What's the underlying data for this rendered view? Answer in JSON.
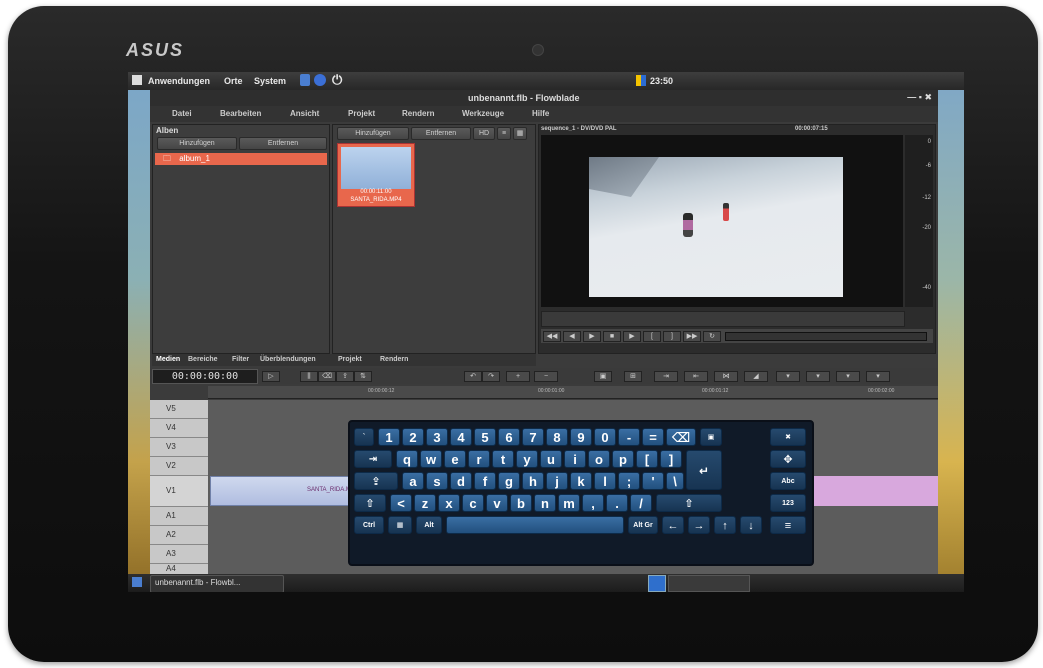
{
  "device": {
    "brand": "ASUS"
  },
  "topbar": {
    "menu_applications": "Anwendungen",
    "menu_places": "Orte",
    "menu_system": "System",
    "clock": "23:50"
  },
  "window": {
    "title": "unbenannt.flb - Flowblade"
  },
  "menubar": {
    "items": [
      "Datei",
      "Bearbeiten",
      "Ansicht",
      "Projekt",
      "Rendern",
      "Werkzeuge",
      "Hilfe"
    ]
  },
  "albums": {
    "header": "Alben",
    "add_button": "Hinzufügen",
    "remove_button": "Entfernen",
    "items": [
      "album_1"
    ]
  },
  "media": {
    "add_button": "Hinzufügen",
    "remove_button": "Entfernen",
    "hd_label": "HD",
    "clip_name": "SANTA_RIDA.MP4",
    "clip_duration": "00:00:11:00"
  },
  "monitor": {
    "sequence_label": "sequence_1 - DV/DVD PAL",
    "timecode": "00:00:07:15",
    "vu_labels": [
      "0",
      "-6",
      "-12",
      "-20",
      "-40"
    ]
  },
  "notebook_tabs": [
    "Medien",
    "Bereiche",
    "Filter",
    "Überblendungen",
    "Projekt",
    "Rendern"
  ],
  "timeline": {
    "timecode": "00:00:00:00",
    "ruler_ticks": [
      "00:00:00:12",
      "00:00:01:00",
      "00:00:01:12",
      "00:00:02:00"
    ],
    "video_tracks": [
      "V5",
      "V4",
      "V3",
      "V2",
      "V1"
    ],
    "audio_tracks": [
      "A1",
      "A2",
      "A3",
      "A4"
    ],
    "clip_label": "SANTA_RIDA.MP4"
  },
  "keyboard": {
    "row1": [
      "`",
      "1",
      "2",
      "3",
      "4",
      "5",
      "6",
      "7",
      "8",
      "9",
      "0",
      "-",
      "="
    ],
    "row2": [
      "q",
      "w",
      "e",
      "r",
      "t",
      "y",
      "u",
      "i",
      "o",
      "p",
      "[",
      "]"
    ],
    "row3": [
      "a",
      "s",
      "d",
      "f",
      "g",
      "h",
      "j",
      "k",
      "l",
      ";",
      "'",
      "\\"
    ],
    "row4": [
      "<",
      "z",
      "x",
      "c",
      "v",
      "b",
      "n",
      "m",
      ",",
      ".",
      "/"
    ],
    "ctrl": "Ctrl",
    "alt": "Alt",
    "altgr": "Alt Gr",
    "abc": "Abc",
    "num": "123",
    "close": "✖",
    "tab": "⇥",
    "caps": "⇪",
    "shift": "⇧",
    "enter": "↵",
    "backspace": "⌫",
    "left": "←",
    "right": "→",
    "up": "↑",
    "down": "↓",
    "menu": "≡"
  },
  "taskbar": {
    "window_title": "unbenannt.flb - Flowbl..."
  }
}
